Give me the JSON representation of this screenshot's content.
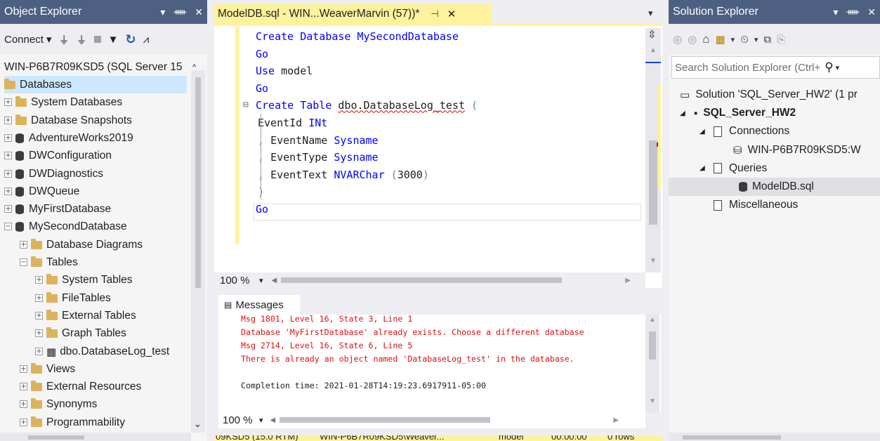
{
  "object_explorer": {
    "title": "Object Explorer",
    "title_buttons": [
      "▾",
      "⊥",
      "✕"
    ],
    "connect_label": "Connect ▾",
    "server_node": "WIN-P6B7R09KSD5 (SQL Server 15",
    "nodes": [
      {
        "label": "Databases",
        "expand": "",
        "icon": "folder-icon",
        "selected": true
      },
      {
        "label": "System Databases",
        "expand": "+",
        "icon": "folder-icon"
      },
      {
        "label": "Database Snapshots",
        "expand": "+",
        "icon": "folder-icon"
      },
      {
        "label": "AdventureWorks2019",
        "expand": "+",
        "icon": "database-icon"
      },
      {
        "label": "DWConfiguration",
        "expand": "+",
        "icon": "database-icon"
      },
      {
        "label": "DWDiagnostics",
        "expand": "+",
        "icon": "database-icon"
      },
      {
        "label": "DWQueue",
        "expand": "+",
        "icon": "database-icon"
      },
      {
        "label": "MyFirstDatabase",
        "expand": "+",
        "icon": "database-icon"
      },
      {
        "label": "MySecondDatabase",
        "expand": "−",
        "icon": "database-icon"
      },
      {
        "label": "Database Diagrams",
        "expand": "+",
        "icon": "folder-icon"
      },
      {
        "label": "Tables",
        "expand": "−",
        "icon": "folder-icon"
      },
      {
        "label": "System Tables",
        "expand": "+",
        "icon": "folder-icon"
      },
      {
        "label": "FileTables",
        "expand": "+",
        "icon": "folder-icon"
      },
      {
        "label": "External Tables",
        "expand": "+",
        "icon": "folder-icon"
      },
      {
        "label": "Graph Tables",
        "expand": "+",
        "icon": "folder-icon"
      },
      {
        "label": "dbo.DatabaseLog_test",
        "expand": "+",
        "icon": "table-icon"
      },
      {
        "label": "Views",
        "expand": "+",
        "icon": "folder-icon"
      },
      {
        "label": "External Resources",
        "expand": "+",
        "icon": "folder-icon"
      },
      {
        "label": "Synonyms",
        "expand": "+",
        "icon": "folder-icon"
      },
      {
        "label": "Programmability",
        "expand": "+",
        "icon": "folder-icon"
      }
    ]
  },
  "editor": {
    "tab_title": "ModelDB.sql - WIN...WeaverMarvin (57))*",
    "tab_pin": "⊣",
    "tab_close": "✕",
    "dropdown_arrow": "▾",
    "code_lines": [
      [
        {
          "t": "Create Database ",
          "c": "kw"
        },
        {
          "t": "MySecondDatabase",
          "c": "kw"
        }
      ],
      [
        {
          "t": "Go",
          "c": "kw"
        }
      ],
      [
        {
          "t": "Use ",
          "c": "kw"
        },
        {
          "t": "model",
          "c": ""
        }
      ],
      [
        {
          "t": "Go",
          "c": "kw"
        }
      ],
      [
        {
          "t": "Create Table ",
          "c": "kw"
        },
        {
          "t": "dbo.DatabaseLog_test",
          "c": "squig"
        },
        {
          "t": " (",
          "c": "gray"
        }
      ],
      [
        {
          "t": "EventId ",
          "c": ""
        },
        {
          "t": "INt",
          "c": "kw"
        }
      ],
      [
        {
          "t": ", ",
          "c": "gray"
        },
        {
          "t": "EventName ",
          "c": ""
        },
        {
          "t": "Sysname",
          "c": "kw"
        }
      ],
      [
        {
          "t": ", ",
          "c": "gray"
        },
        {
          "t": "EventType ",
          "c": ""
        },
        {
          "t": "Sysname",
          "c": "kw"
        }
      ],
      [
        {
          "t": ", ",
          "c": "gray"
        },
        {
          "t": "EventText ",
          "c": ""
        },
        {
          "t": "NVARChar",
          "c": "kw"
        },
        {
          "t": " (",
          "c": "gray"
        },
        {
          "t": "3000",
          "c": ""
        },
        {
          "t": ")",
          "c": "gray"
        }
      ],
      [
        {
          "t": ")",
          "c": "gray"
        }
      ],
      [
        {
          "t": "Go",
          "c": "kw"
        }
      ]
    ],
    "zoom": "100 %",
    "messages_tab": "Messages",
    "messages": [
      "Msg 1801, Level 16, State 3, Line 1",
      "Database 'MyFirstDatabase' already exists. Choose a different database",
      "Msg 2714, Level 16, State 6, Line 5",
      "There is already an object named 'DatabaseLog_test' in the database."
    ],
    "completion": "Completion time: 2021-01-28T14:19:23.6917911-05:00",
    "messages_zoom": "100 %",
    "status": {
      "server": "09KSD5 (15.0 RTM)",
      "user": "WIN-P6B7R09KSD5\\Weaver...",
      "database": "model",
      "elapsed": "00:00:00",
      "rows": "0 rows"
    }
  },
  "solution_explorer": {
    "title": "Solution Explorer",
    "title_buttons": [
      "▾",
      "⊥",
      "✕"
    ],
    "search_placeholder": "Search Solution Explorer (Ctrl+",
    "items": [
      {
        "label": "Solution 'SQL_Server_HW2' (1 pr",
        "level": 0,
        "icon": "solution-icon",
        "tri": ""
      },
      {
        "label": "SQL_Server_HW2",
        "level": 1,
        "icon": "project-icon",
        "tri": "◢",
        "bold": true
      },
      {
        "label": "Connections",
        "level": 2,
        "icon": "page-icon",
        "tri": "◢"
      },
      {
        "label": "WIN-P6B7R09KSD5:W",
        "level": 3,
        "icon": "connection-icon",
        "tri": ""
      },
      {
        "label": "Queries",
        "level": 2,
        "icon": "page-icon",
        "tri": "◢"
      },
      {
        "label": "ModelDB.sql",
        "level": 3,
        "icon": "database-icon",
        "tri": "",
        "selected": true
      },
      {
        "label": "Miscellaneous",
        "level": 2,
        "icon": "page-icon",
        "tri": ""
      }
    ]
  },
  "colors": {
    "title_active": "#fff29d",
    "title_inactive": "#4d6082",
    "keyword": "#0000ff",
    "error": "#e01010",
    "selected": "#cce8ff",
    "status_bar": "#fff29d"
  }
}
